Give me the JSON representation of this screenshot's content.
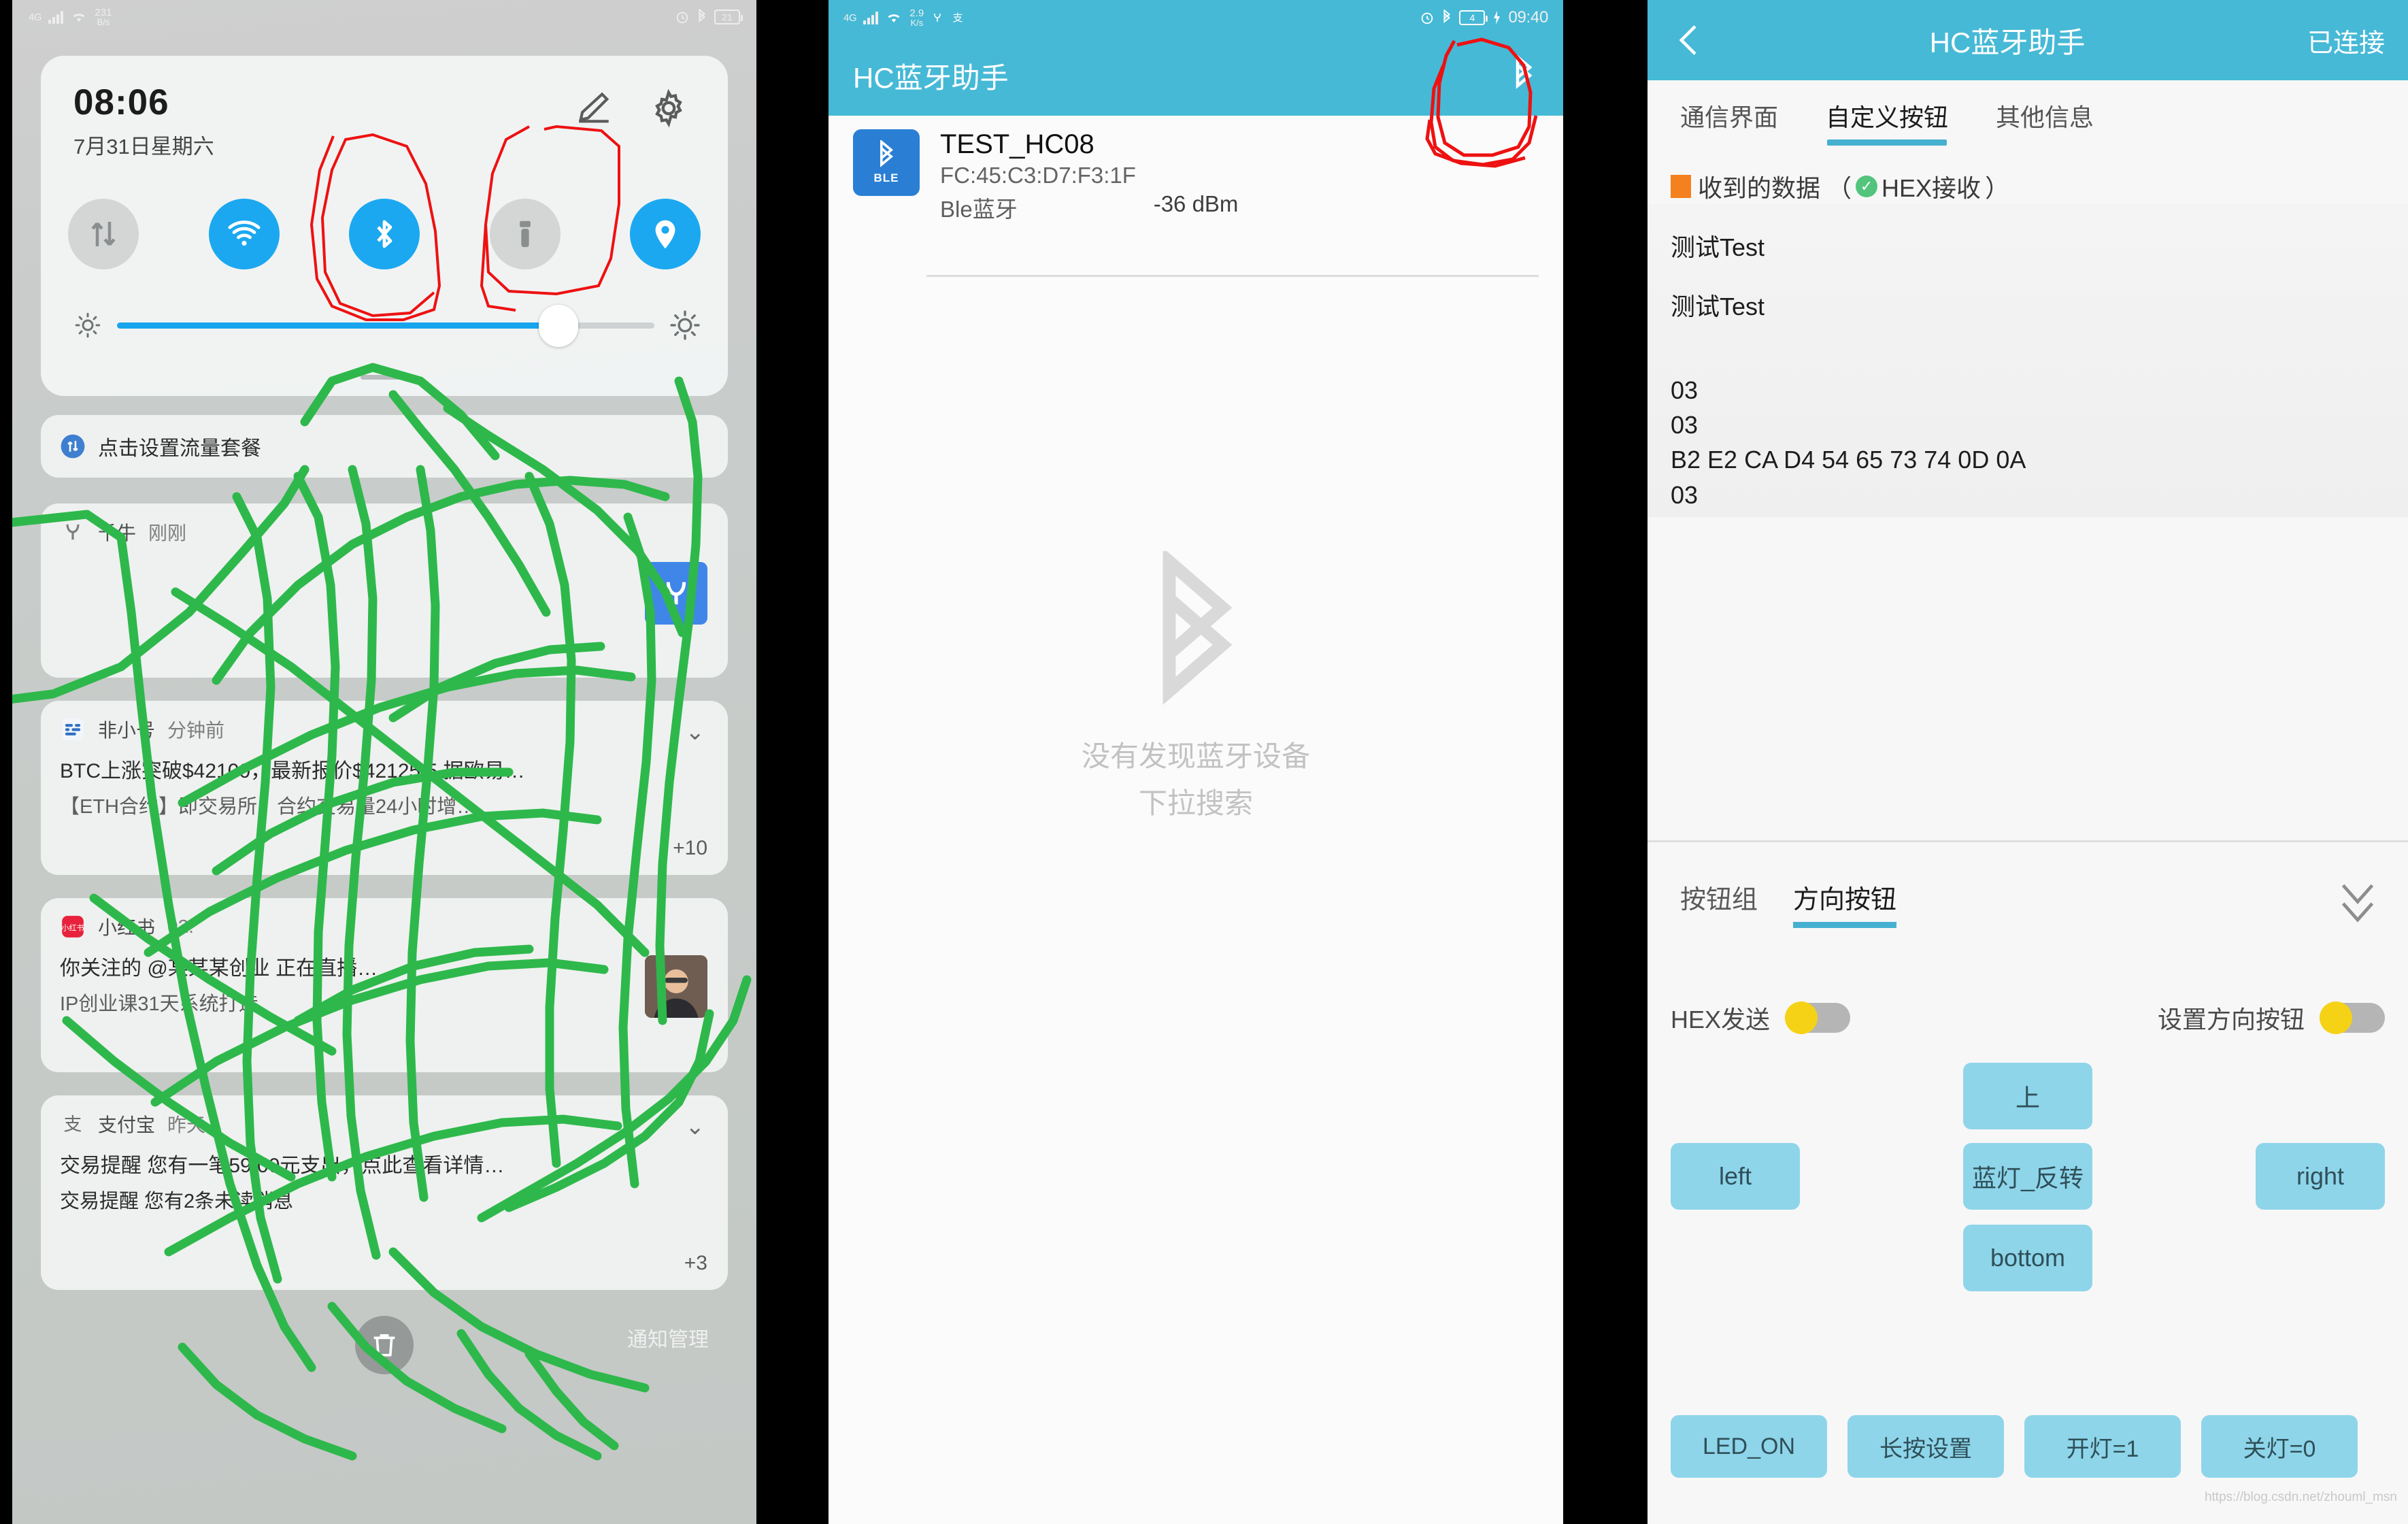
{
  "panel1": {
    "statusbar": {
      "network_gen": "4G",
      "data_rate_value": "231",
      "data_rate_unit": "B/s",
      "battery": "21",
      "icons": [
        "signal-bars-icon",
        "wifi-icon",
        "alarm-icon",
        "bluetooth-icon",
        "battery-icon"
      ]
    },
    "quick_settings": {
      "time": "08:06",
      "date": "7月31日星期六",
      "edit_icon": "pencil-icon",
      "settings_icon": "gear-icon",
      "toggles": [
        {
          "name": "mobile-data",
          "icon": "data-arrows-icon",
          "state": "off"
        },
        {
          "name": "wifi",
          "icon": "wifi-icon",
          "state": "on"
        },
        {
          "name": "bluetooth",
          "icon": "bluetooth-icon",
          "state": "on"
        },
        {
          "name": "flashlight",
          "icon": "flashlight-icon",
          "state": "off"
        },
        {
          "name": "location",
          "icon": "location-pin-icon",
          "state": "on"
        }
      ],
      "brightness_percent": 81
    },
    "notifications": [
      {
        "app": "",
        "time": "",
        "icon": "data-plan-icon",
        "title": "点击设置流量套餐",
        "body": "",
        "sub": "",
        "chevron": false,
        "plus": ""
      },
      {
        "app": "千牛",
        "time": "刚刚",
        "icon": "qianniu-icon",
        "title": "",
        "body": "",
        "sub": "",
        "chevron": false,
        "plus": "",
        "thumb": "qianniu-app-thumb"
      },
      {
        "app": "非小号",
        "time": "分钟前",
        "icon": "feixiaohao-icon",
        "title": "BTC上涨突破$42100，最新报价$42125.5 据欧易…",
        "sub": "【ETH合约】即交易所，合约交易量24小时增…",
        "chevron": true,
        "plus": "+10"
      },
      {
        "app": "小红书",
        "time": "02:",
        "icon": "xiaohongshu-icon",
        "title": "你关注的 @某某某创业 正在直播…",
        "sub": "IP创业课31天系统打造",
        "chevron": false,
        "plus": "",
        "thumb": "live-avatar-thumb"
      },
      {
        "app": "支付宝",
        "time": "昨天",
        "icon": "alipay-icon",
        "title": "交易提醒 您有一笔59.00元支出，点此查看详情…",
        "sub": "交易提醒 您有2条未读消息",
        "chevron": true,
        "plus": "+3"
      }
    ],
    "clear_all_icon": "trash-icon",
    "notification_manage_label": "通知管理"
  },
  "panel2": {
    "statusbar": {
      "network_gen": "4G",
      "data_rate_value": "2.9",
      "data_rate_unit": "K/s",
      "battery": "4",
      "time": "09:40",
      "icons": [
        "signal-bars-icon",
        "wifi-icon",
        "qianniu-icon",
        "alipay-icon",
        "alarm-icon",
        "bluetooth-icon",
        "battery-icon",
        "charging-icon"
      ]
    },
    "app_title": "HC蓝牙助手",
    "appbar_action_icon": "bluetooth-icon",
    "device": {
      "badge_icon": "bluetooth-icon",
      "badge_text": "BLE",
      "name": "TEST_HC08",
      "mac": "FC:45:C3:D7:F3:1F",
      "type": "Ble蓝牙",
      "rssi": "-36 dBm"
    },
    "empty_icon": "bluetooth-icon",
    "empty_line1": "没有发现蓝牙设备",
    "empty_line2": "下拉搜索"
  },
  "panel3": {
    "back_icon": "chevron-left-icon",
    "app_title": "HC蓝牙助手",
    "connection_status": "已连接",
    "tabs": [
      {
        "label": "通信界面",
        "active": false
      },
      {
        "label": "自定义按钮",
        "active": true
      },
      {
        "label": "其他信息",
        "active": false
      }
    ],
    "receive": {
      "marker_color": "#f5801e",
      "label": "收到的数据",
      "hex_paren_open": "（",
      "hex_check_icon": "check-circle-icon",
      "hex_label": "HEX接收",
      "hex_paren_close": "）",
      "lines": [
        "测试Test",
        "",
        "测试Test",
        "",
        "",
        "03",
        "03",
        "B2 E2 CA D4 54 65 73 74 0D 0A",
        "03"
      ]
    },
    "button_tabs": [
      {
        "label": "按钮组",
        "active": false
      },
      {
        "label": "方向按钮",
        "active": true
      }
    ],
    "expand_icon": "double-chevron-down-icon",
    "switches": [
      {
        "label": "HEX发送",
        "state": "off",
        "knob_color": "#F5D216"
      },
      {
        "label": "设置方向按钮",
        "state": "off",
        "knob_color": "#F5D216"
      }
    ],
    "direction_buttons": {
      "up": "上",
      "left": "left",
      "center": "蓝灯_反转",
      "right": "right",
      "bottom": "bottom"
    },
    "command_buttons": [
      "LED_ON",
      "长按设置",
      "开灯=1",
      "关灯=0"
    ],
    "watermark": "https://blog.csdn.net/zhouml_msn"
  }
}
